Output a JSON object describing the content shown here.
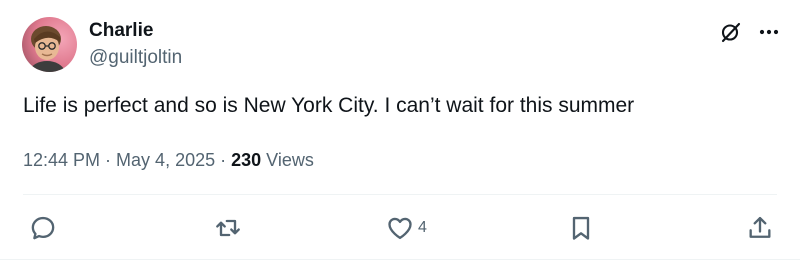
{
  "author": {
    "display_name": "Charlie",
    "handle": "@guiltjoltin",
    "avatar_icon": "profile-photo"
  },
  "tweet": {
    "text": "Life is perfect and so is New York City. I can’t wait for this summer"
  },
  "meta": {
    "time": "12:44 PM",
    "separator_1": " · ",
    "date": "May 4, 2025",
    "separator_2": " · ",
    "views_count": "230",
    "views_label": " Views"
  },
  "actions": {
    "reply_icon": "reply-icon",
    "retweet_icon": "retweet-icon",
    "like_icon": "heart-icon",
    "like_count": "4",
    "bookmark_icon": "bookmark-icon",
    "share_icon": "share-icon"
  },
  "header_actions": {
    "grok_icon": "grok-icon",
    "more_icon": "more-icon"
  },
  "colors": {
    "text_primary": "#0f1419",
    "text_secondary": "#536471",
    "divider": "#eff3f4"
  }
}
